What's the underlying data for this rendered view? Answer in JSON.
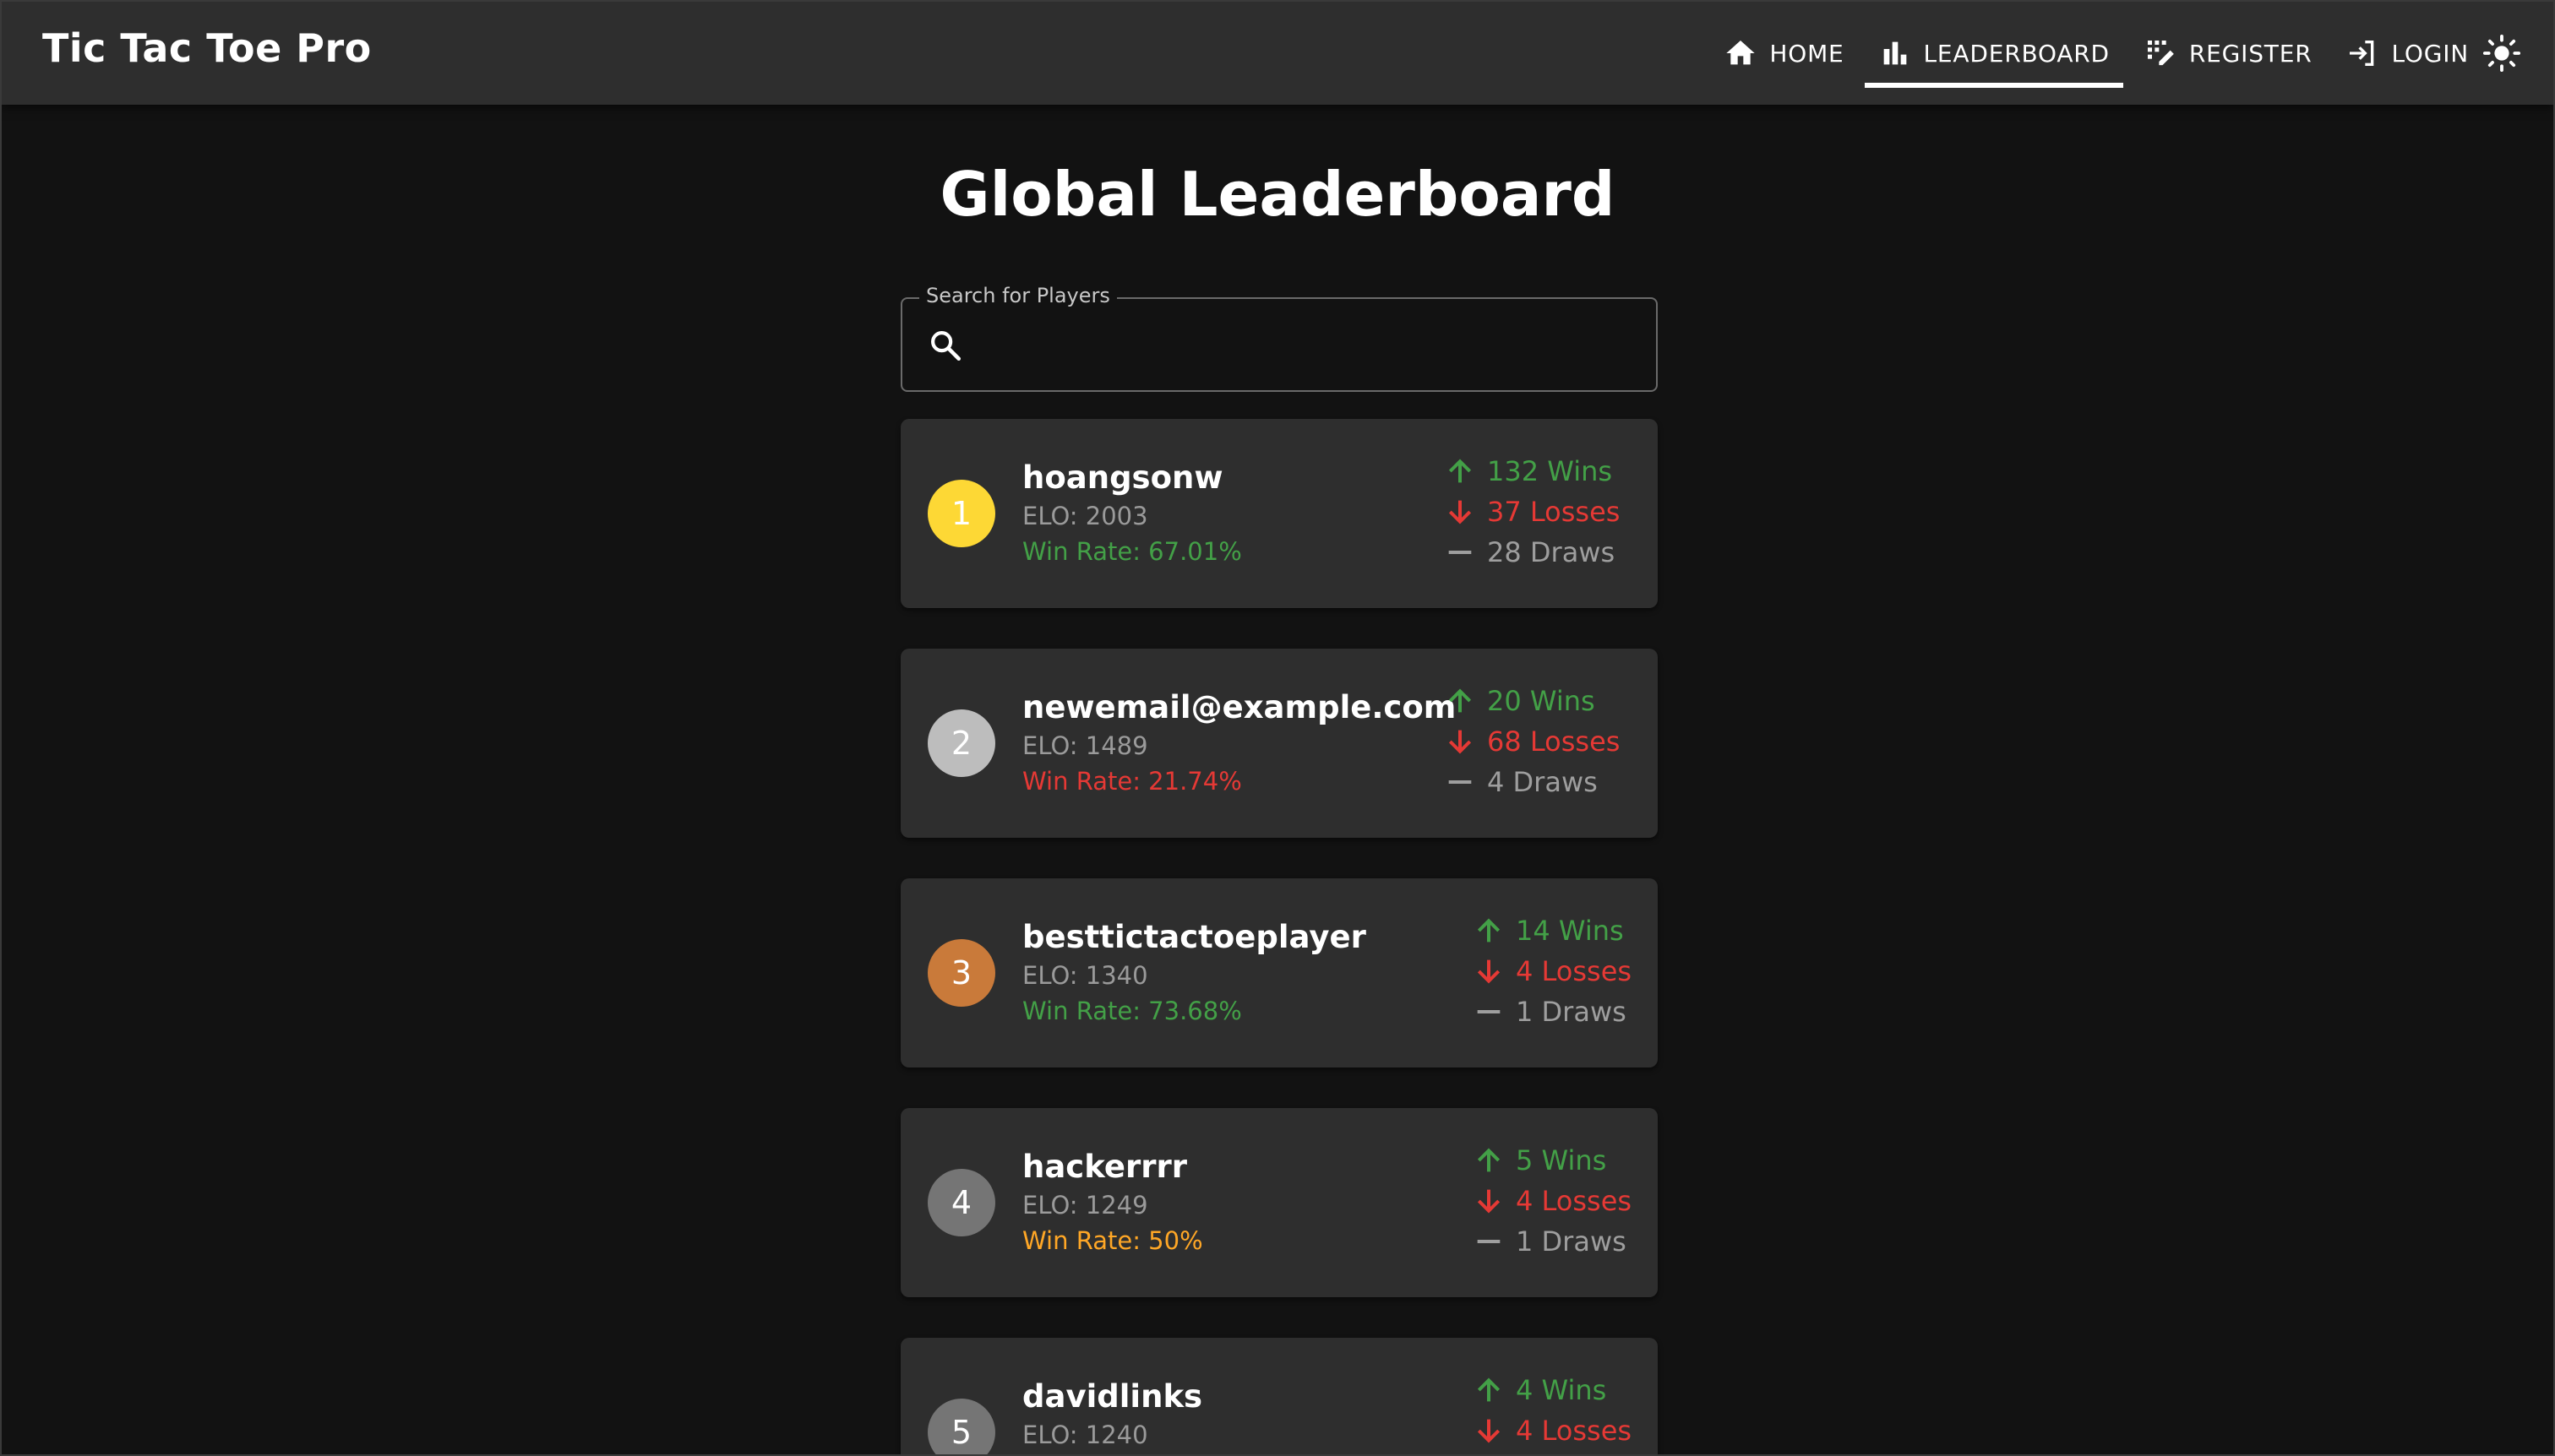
{
  "app": {
    "title": "Tic Tac Toe Pro"
  },
  "nav": {
    "items": [
      {
        "label": "HOME",
        "icon": "home-icon",
        "active": false
      },
      {
        "label": "LEADERBOARD",
        "icon": "bar-chart-icon",
        "active": true
      },
      {
        "label": "REGISTER",
        "icon": "register-icon",
        "active": false
      },
      {
        "label": "LOGIN",
        "icon": "login-icon",
        "active": false
      }
    ],
    "theme_toggle_icon": "sun-icon"
  },
  "page": {
    "title": "Global Leaderboard"
  },
  "search": {
    "label": "Search for Players",
    "value": "",
    "icon": "search-icon"
  },
  "colors": {
    "gold": "#fdd835",
    "silver": "#bdbdbd",
    "bronze": "#c97a3a",
    "default_rank": "#757575",
    "wins": "#43a047",
    "losses": "#e53935",
    "draws": "#9e9e9e",
    "winrate_mid": "#ffa726"
  },
  "players": [
    {
      "rank": "1",
      "name": "hoangsonw",
      "elo": "ELO: 2003",
      "win_rate": "Win Rate: 67.01%",
      "wins": "132 Wins",
      "losses": "37 Losses",
      "draws": "28 Draws"
    },
    {
      "rank": "2",
      "name": "newemail@example.com",
      "elo": "ELO: 1489",
      "win_rate": "Win Rate: 21.74%",
      "wins": "20 Wins",
      "losses": "68 Losses",
      "draws": "4 Draws"
    },
    {
      "rank": "3",
      "name": "besttictactoeplayer",
      "elo": "ELO: 1340",
      "win_rate": "Win Rate: 73.68%",
      "wins": "14 Wins",
      "losses": "4 Losses",
      "draws": "1 Draws"
    },
    {
      "rank": "4",
      "name": "hackerrrr",
      "elo": "ELO: 1249",
      "win_rate": "Win Rate: 50%",
      "wins": "5 Wins",
      "losses": "4 Losses",
      "draws": "1 Draws"
    },
    {
      "rank": "5",
      "name": "davidlinks",
      "elo": "ELO: 1240",
      "win_rate": "",
      "wins": "4 Wins",
      "losses": "4 Losses",
      "draws": ""
    }
  ]
}
